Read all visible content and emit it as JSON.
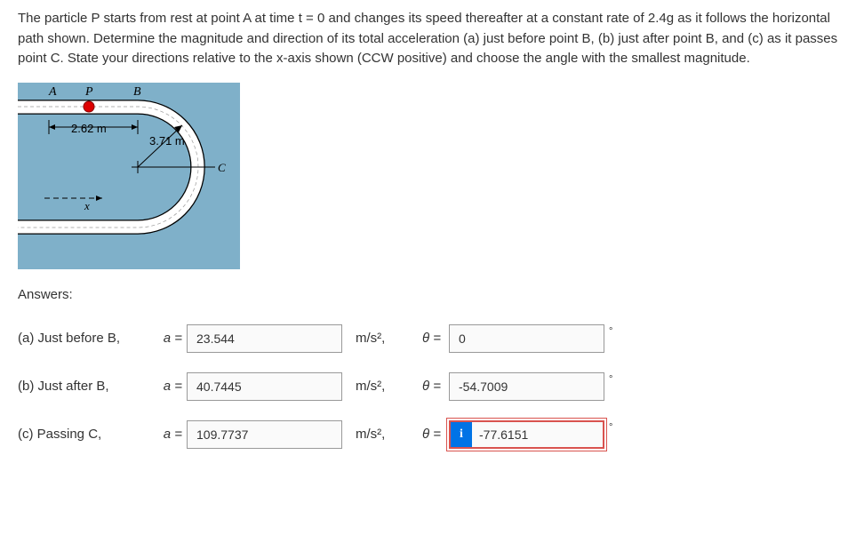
{
  "problem": {
    "text": "The particle P starts from rest at point A at time t = 0 and changes its speed thereafter at a constant rate of 2.4g as it follows the horizontal path shown. Determine the magnitude and direction of its total acceleration (a) just before point B, (b) just after point B, and (c) as it passes point C. State your directions relative to the x-axis shown (CCW positive) and choose the angle with the smallest magnitude."
  },
  "diagram": {
    "labelA": "A",
    "labelP": "P",
    "labelB": "B",
    "labelC": "C",
    "dim1": "2.62 m",
    "dim2": "3.71 m",
    "axisX": "x"
  },
  "answersLabel": "Answers:",
  "rows": {
    "a": {
      "label": "(a) Just before B,",
      "aEq": "a =",
      "aVal": "23.544",
      "unit": "m/s²,",
      "thetaEq": "θ =",
      "thetaVal": "0"
    },
    "b": {
      "label": "(b) Just after B,",
      "aEq": "a =",
      "aVal": "40.7445",
      "unit": "m/s²,",
      "thetaEq": "θ =",
      "thetaVal": "-54.7009"
    },
    "c": {
      "label": "(c) Passing C,",
      "aEq": "a =",
      "aVal": "109.7737",
      "unit": "m/s²,",
      "thetaEq": "θ =",
      "thetaVal": "-77.6151",
      "infoIcon": "i"
    }
  },
  "degSymbol": "°"
}
